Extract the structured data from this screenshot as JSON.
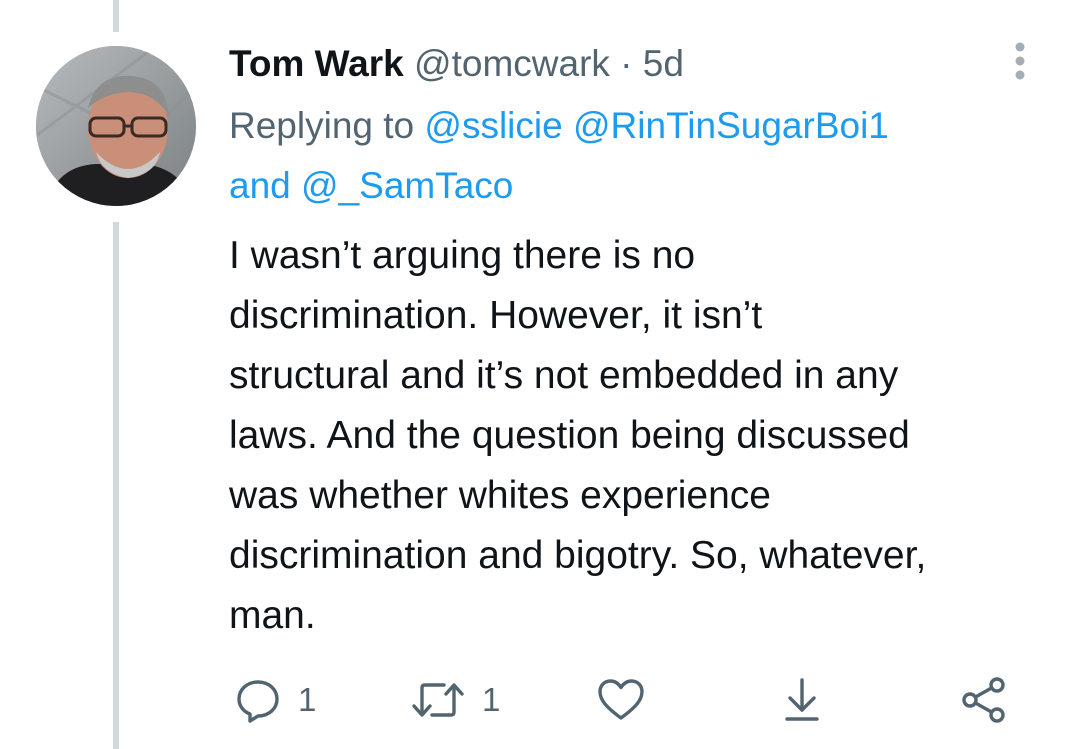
{
  "tweet": {
    "author_name": "Tom Wark",
    "author_handle": "@tomcwark",
    "separator": "·",
    "time": "5d",
    "replying": {
      "prefix": "Replying to",
      "mention_1": "@sslicie",
      "mention_2": "@RinTinSugarBoi1",
      "conjunction": "and",
      "mention_3": "@_SamTaco"
    },
    "text_lines": [
      "I wasn’t arguing there is no",
      "discrimination. However, it isn’t",
      "structural and it’s not embedded in any",
      "laws. And the question being discussed",
      "was whether whites experience",
      "discrimination and bigotry. So, whatever,",
      "man."
    ]
  },
  "actions": {
    "reply_count": "1",
    "retweet_count": "1",
    "icons": [
      "reply-icon",
      "retweet-icon",
      "like-icon",
      "download-icon",
      "share-icon",
      "more-icon"
    ]
  },
  "colors": {
    "text": "#0f1419",
    "secondary": "#536471",
    "link": "#1d9bf0",
    "thread_line": "#cfd9de"
  }
}
